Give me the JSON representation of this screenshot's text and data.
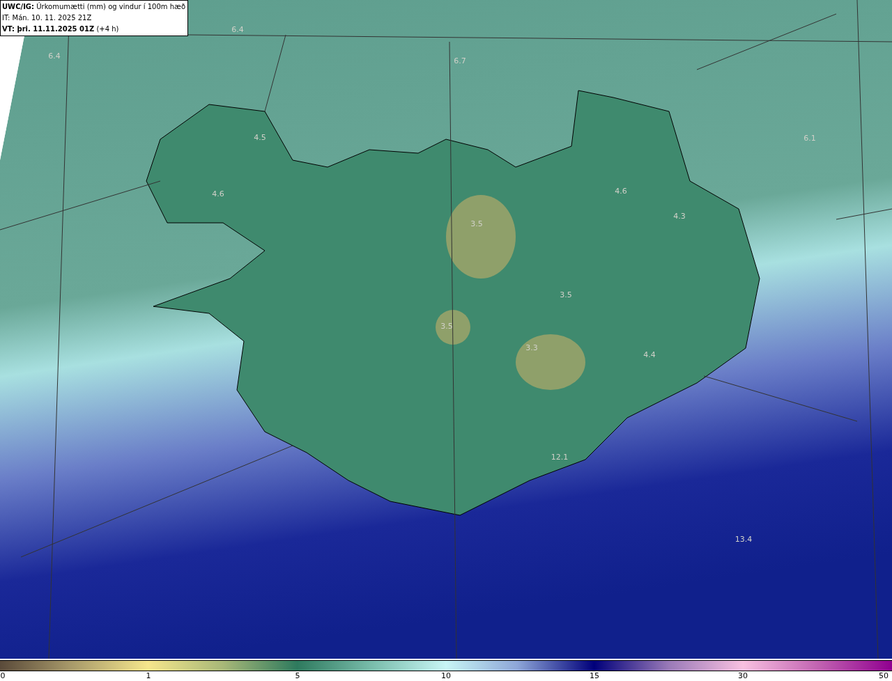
{
  "header": {
    "lines": [
      "**UWC/IG:** Úrkomumætti (mm) og vindur í 100m hæð",
      "IT: Mán. 10. 11. 2025 21Z",
      "**VT: þri. 11.11.2025 01Z** (+4 h)"
    ]
  },
  "map": {
    "labels": [
      "6.4",
      "6.4",
      "6.7",
      "6.1",
      "4.5",
      "4.6",
      "4.6",
      "4.3",
      "3.5",
      "3.5",
      "3.5",
      "3.3",
      "4.4",
      "12.1",
      "13.4"
    ]
  },
  "colorbar": {
    "ticks": [
      "0",
      "1",
      "5",
      "10",
      "15",
      "30",
      "50"
    ]
  }
}
